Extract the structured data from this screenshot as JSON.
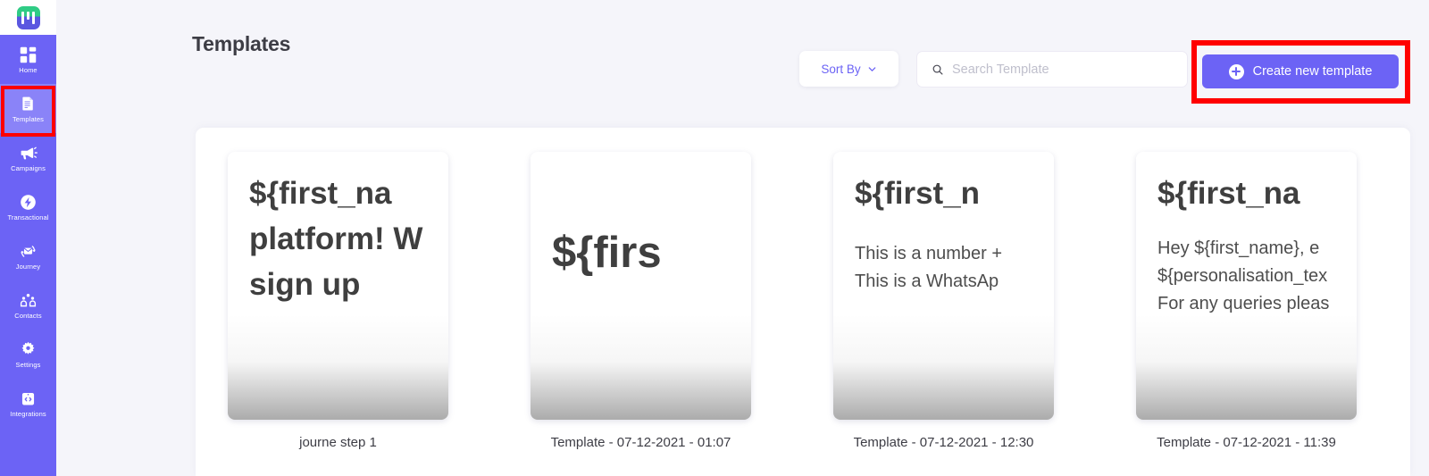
{
  "app": {
    "logo_name": "app-logo",
    "accent": "#6c63f5",
    "sidebar_bg": "#6c63f5",
    "active_bg": "#8a83f8",
    "highlight_color": "#ff0000",
    "page_bg": "#f5f5fa"
  },
  "sidebar": {
    "items": [
      {
        "label": "Home",
        "icon": "grid-icon",
        "active": false
      },
      {
        "label": "Templates",
        "icon": "document-icon",
        "active": true
      },
      {
        "label": "Campaigns",
        "icon": "megaphone-icon",
        "active": false
      },
      {
        "label": "Transactional",
        "icon": "bolt-icon",
        "active": false
      },
      {
        "label": "Journey",
        "icon": "envelope-loop-icon",
        "active": false
      },
      {
        "label": "Contacts",
        "icon": "people-icon",
        "active": false
      },
      {
        "label": "Settings",
        "icon": "gear-icon",
        "active": false
      },
      {
        "label": "Integrations",
        "icon": "code-clipboard-icon",
        "active": false
      }
    ]
  },
  "header": {
    "title": "Templates"
  },
  "toolbar": {
    "sort_label": "Sort By",
    "sort_icon": "chevron-down-icon",
    "search_icon": "search-icon",
    "search_placeholder": "Search Template",
    "search_value": "",
    "create_label": "Create new template",
    "create_icon": "plus-circle-icon"
  },
  "templates": [
    {
      "label": "journe step 1",
      "variant": "v1",
      "heading_lines": [
        "${first_na",
        "platform! W",
        "sign up"
      ],
      "body_lines": []
    },
    {
      "label": "Template - 07-12-2021 - 01:07",
      "variant": "v2",
      "heading_lines": [
        "${firs"
      ],
      "body_lines": []
    },
    {
      "label": "Template - 07-12-2021 - 12:30",
      "variant": "v3",
      "heading_lines": [
        "${first_n"
      ],
      "body_lines": [
        "This is a number +",
        "This is a WhatsAp"
      ]
    },
    {
      "label": "Template - 07-12-2021 - 11:39",
      "variant": "v4",
      "heading_lines": [
        "${first_na"
      ],
      "body_lines": [
        "Hey ${first_name}, e",
        "${personalisation_tex",
        "For any queries pleas"
      ]
    }
  ]
}
